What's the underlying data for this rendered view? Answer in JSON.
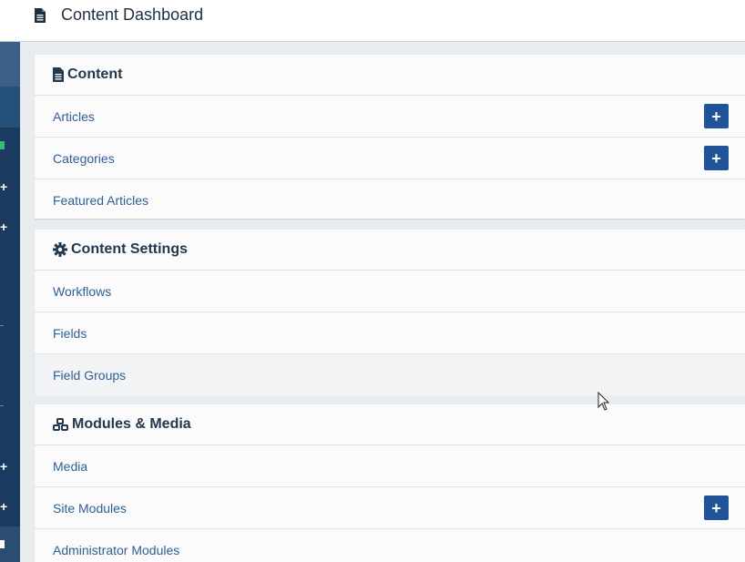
{
  "header": {
    "title": "Content Dashboard",
    "icon": "file-icon"
  },
  "sections": [
    {
      "title": "Content",
      "icon": "file-icon",
      "items": [
        {
          "label": "Articles",
          "add": true
        },
        {
          "label": "Categories",
          "add": true
        },
        {
          "label": "Featured Articles",
          "add": false
        }
      ]
    },
    {
      "title": "Content Settings",
      "icon": "gear-icon",
      "items": [
        {
          "label": "Workflows",
          "add": false
        },
        {
          "label": "Fields",
          "add": false
        },
        {
          "label": "Field Groups",
          "add": false
        }
      ]
    },
    {
      "title": "Modules & Media",
      "icon": "cubes-icon",
      "items": [
        {
          "label": "Media",
          "add": false
        },
        {
          "label": "Site Modules",
          "add": true
        },
        {
          "label": "Administrator Modules",
          "add": false
        }
      ]
    }
  ],
  "add_button_symbol": "+",
  "colors": {
    "sidebar": "#1a3a5f",
    "accent_button": "#1f5499",
    "link": "#2f5f96",
    "heading": "#22384f",
    "sidebar_green": "#3cb878"
  }
}
